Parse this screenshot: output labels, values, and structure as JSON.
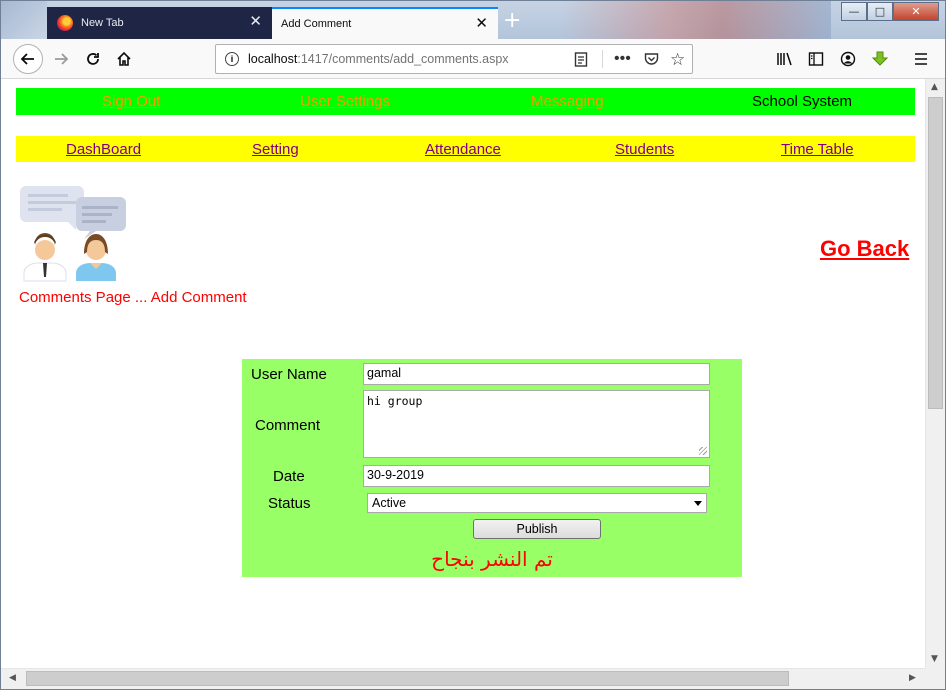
{
  "browser": {
    "tabs": [
      {
        "label": "New Tab",
        "active": false
      },
      {
        "label": "Add Comment",
        "active": true
      }
    ],
    "close_glyph": "✕",
    "new_tab_glyph": "+",
    "url_host": "localhost",
    "url_path": ":1417/comments/add_comments.aspx",
    "window_buttons": {
      "minimize": "—",
      "maximize": "□",
      "close": "✕"
    }
  },
  "top_menu": {
    "items": [
      "Sign Out",
      "User Settings",
      "Messaging"
    ],
    "brand": "School System",
    "bg_color": "#00ff00",
    "link_color": "#ff9900"
  },
  "sub_menu": {
    "items": [
      "DashBoard",
      "Setting",
      "Attendance",
      "Students",
      "Time Table"
    ],
    "bg_color": "#ffff00",
    "link_color": "#800080"
  },
  "page": {
    "title": "Comments Page ... Add Comment",
    "go_back": "Go Back",
    "logo_icon": "comments-people-icon"
  },
  "form": {
    "bg_color": "#99ff66",
    "username_label": "User Name",
    "username_value": "gamal",
    "comment_label": "Comment",
    "comment_value": "hi group",
    "date_label": "Date",
    "date_value": "30-9-2019",
    "status_label": "Status",
    "status_value": "Active",
    "publish_label": "Publish",
    "success_message": "تم النشر بنجاح"
  }
}
